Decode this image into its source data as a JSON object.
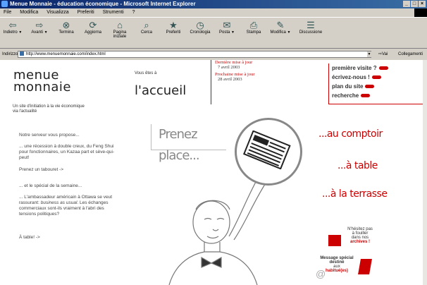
{
  "window": {
    "title": "Menue Monnaie - éducation économique - Microsoft Internet Explorer"
  },
  "menu": [
    "File",
    "Modifica",
    "Visualizza",
    "Preferiti",
    "Strumenti",
    "?"
  ],
  "toolbar": [
    {
      "label": "Indietro",
      "icon": "back-arrow-icon"
    },
    {
      "label": "Avanti",
      "icon": "forward-arrow-icon"
    },
    {
      "label": "Termina",
      "icon": "stop-icon"
    },
    {
      "label": "Aggiorna",
      "icon": "refresh-icon"
    },
    {
      "label": "Pagina iniziale",
      "icon": "home-icon"
    },
    {
      "label": "Cerca",
      "icon": "search-icon"
    },
    {
      "label": "Preferiti",
      "icon": "favorites-icon"
    },
    {
      "label": "Cronologia",
      "icon": "history-icon"
    },
    {
      "label": "Posta",
      "icon": "mail-icon"
    },
    {
      "label": "Stampa",
      "icon": "print-icon"
    },
    {
      "label": "Modifica",
      "icon": "edit-icon"
    },
    {
      "label": "Discussione",
      "icon": "discuss-icon"
    }
  ],
  "address": {
    "label": "Indirizzo",
    "url": "http://www.menuemonnaie.com/index.html",
    "go": "Vai",
    "links": "Collegamenti"
  },
  "page": {
    "logo_line1": "menue",
    "logo_line2": "monnaie",
    "tagline": "Un site d'initiation à la vie économique via l'actualité",
    "vous_etes": "Vous êtes à",
    "accueil": "l'accueil",
    "update_label": "Dernière mise à jour",
    "update_date": "7 avril 2003",
    "next_label": "Prochaine mise à jour",
    "next_date": "28 avril 2003",
    "nav": [
      "première visite ?",
      "écrivez-nous !",
      "plan du site",
      "recherche"
    ],
    "server_head": "Notre serveur vous propose...",
    "server_text": "... une récession à double creux, du Feng Shui pour fonctionnaires, un Kazaa part et sève-qui-peut!",
    "server_link": "Prenez un tabouret ->",
    "special_head": "... et le spécial de la semaine...",
    "special_text_1": "... L'ambassadeur américain à Ottawa se veut rassurant:",
    "special_text_2": "business as usual",
    "special_text_3": ". Les échanges commerciaux sont-ils vraiment à l'abri des tensions politiques?",
    "special_link": "À table! ->",
    "prenez": "Prenez place...",
    "comptoir": "...au comptoir",
    "table": "...à table",
    "terrasse": "...à la terrasse",
    "archives_1": "N'hésitez pas",
    "archives_2": "à fouiller",
    "archives_3": "dans nos",
    "archives_4": "archives !",
    "special_1": "Message spécial",
    "special_2": "destiné",
    "special_3": "aux",
    "special_4": "habitué(es)"
  }
}
